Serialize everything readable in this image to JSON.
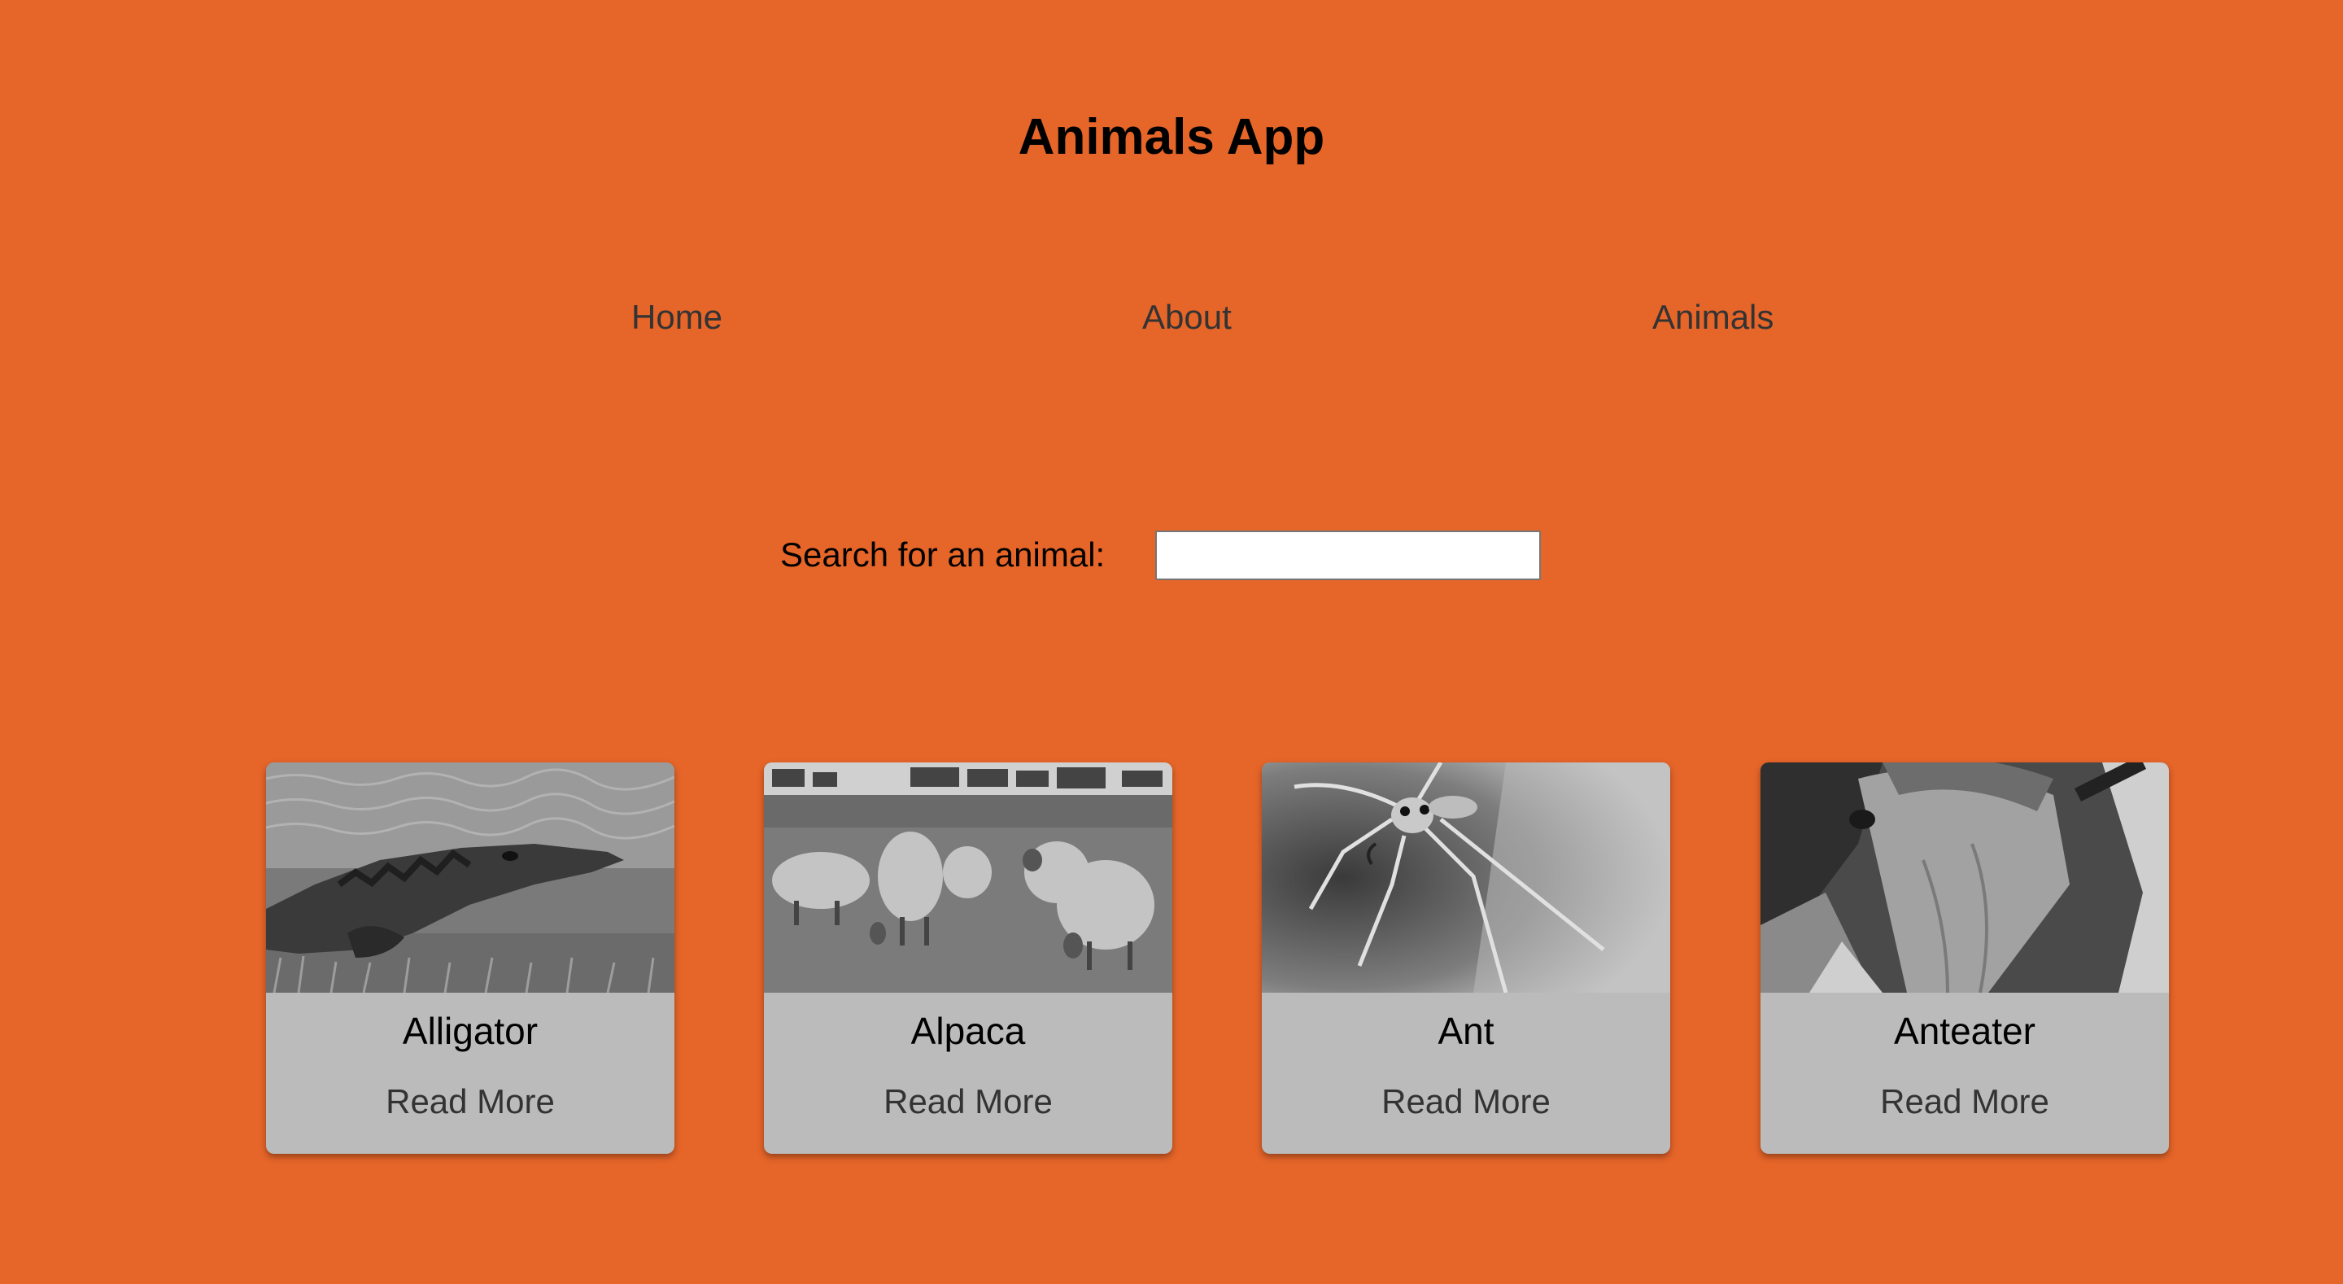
{
  "app": {
    "title": "Animals App"
  },
  "nav": {
    "home": "Home",
    "about": "About",
    "animals": "Animals"
  },
  "search": {
    "label": "Search for an animal:",
    "value": "",
    "placeholder": ""
  },
  "cards": [
    {
      "name": "Alligator",
      "link": "Read More",
      "image": "alligator-photo"
    },
    {
      "name": "Alpaca",
      "link": "Read More",
      "image": "alpaca-photo"
    },
    {
      "name": "Ant",
      "link": "Read More",
      "image": "ant-photo"
    },
    {
      "name": "Anteater",
      "link": "Read More",
      "image": "anteater-photo"
    }
  ],
  "colors": {
    "background": "#E66529",
    "card": "#BBBBBB",
    "nav_text": "#333333"
  }
}
